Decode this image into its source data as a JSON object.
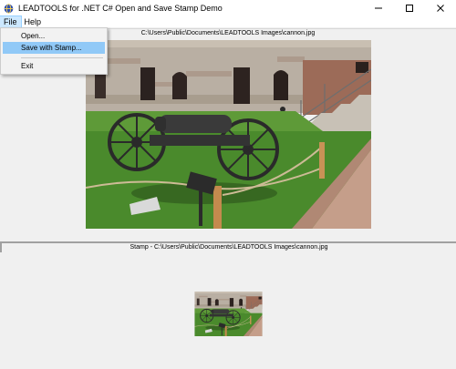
{
  "window": {
    "title": "LEADTOOLS for .NET C# Open and Save Stamp Demo",
    "icon": "leadtools-globe-icon",
    "controls": [
      "minimize-icon",
      "maximize-icon",
      "close-icon"
    ]
  },
  "menubar": {
    "items": [
      {
        "label": "File",
        "active": true
      },
      {
        "label": "Help",
        "active": false
      }
    ]
  },
  "file_menu": {
    "items": [
      {
        "label": "Open...",
        "highlighted": false
      },
      {
        "label": "Save with Stamp...",
        "highlighted": true
      },
      {
        "label": "Exit",
        "highlighted": false
      }
    ]
  },
  "image_panel": {
    "caption": "C:\\Users\\Public\\Documents\\LEADTOOLS Images\\cannon.jpg",
    "image": "cannon-photo"
  },
  "stamp_panel": {
    "caption": "Stamp - C:\\Users\\Public\\Documents\\LEADTOOLS Images\\cannon.jpg",
    "image": "cannon-thumbnail"
  },
  "colors": {
    "menu_highlight": "#91c9f7",
    "background": "#f0f0f0"
  }
}
